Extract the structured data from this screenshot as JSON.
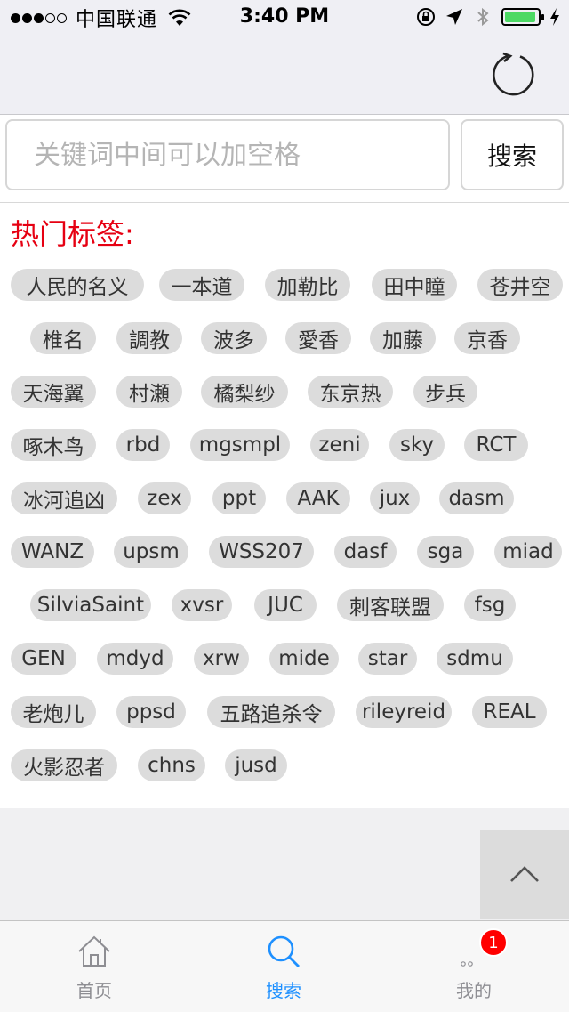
{
  "status_bar": {
    "carrier": "中国联通",
    "time": "3:40 PM"
  },
  "search": {
    "placeholder": "关键词中间可以加空格",
    "button_label": "搜索"
  },
  "hot_tags": {
    "title": "热门标签:",
    "rows": [
      [
        "人民的名义",
        "一本道",
        "加勒比",
        "田中瞳",
        "苍井空"
      ],
      [
        "椎名",
        "調教",
        "波多",
        "愛香",
        "加藤",
        "京香"
      ],
      [
        "天海翼",
        "村瀬",
        "橘梨纱",
        "东京热",
        "步兵"
      ],
      [
        "啄木鸟",
        "rbd",
        "mgsmpl",
        "zeni",
        "sky",
        "RCT"
      ],
      [
        "冰河追凶",
        "zex",
        "ppt",
        "AAK",
        "jux",
        "dasm"
      ],
      [
        "WANZ",
        "upsm",
        "WSS207",
        "dasf",
        "sga",
        "miad"
      ],
      [
        "SilviaSaint",
        "xvsr",
        "JUC",
        "刺客联盟",
        "fsg"
      ],
      [
        "GEN",
        "mdyd",
        "xrw",
        "mide",
        "star",
        "sdmu"
      ],
      [
        "老炮儿",
        "ppsd",
        "五路追杀令",
        "rileyreid",
        "REAL"
      ],
      [
        "火影忍者",
        "chns",
        "jusd"
      ]
    ]
  },
  "tab_bar": {
    "tabs": [
      {
        "label": "首页",
        "icon": "home-icon",
        "active": false
      },
      {
        "label": "搜索",
        "icon": "search-icon",
        "active": true
      },
      {
        "label": "我的",
        "icon": "more-icon",
        "active": false,
        "badge": "1"
      }
    ]
  },
  "colors": {
    "accent": "#1e90ff",
    "tag_title": "#e60012",
    "tag_bg": "#dcdcdc",
    "badge": "#ff0000"
  }
}
